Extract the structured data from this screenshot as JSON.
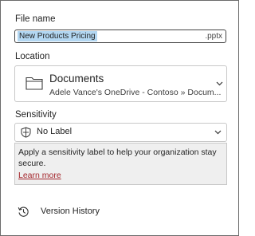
{
  "file_name": {
    "label": "File name",
    "value": "New Products Pricing",
    "extension": ".pptx"
  },
  "location": {
    "label": "Location",
    "folder": "Documents",
    "path": "Adele Vance's OneDrive - Contoso » Docum...",
    "icon": "folder-icon"
  },
  "sensitivity": {
    "label": "Sensitivity",
    "selected": "No Label",
    "icon": "shield-icon",
    "info_text": "Apply a sensitivity label to help your organization stay secure.",
    "learn_more": "Learn more"
  },
  "version_history": {
    "label": "Version History",
    "icon": "history-icon"
  },
  "colors": {
    "selection_highlight": "#b3d7f2",
    "link": "#a4262c",
    "info_background": "#efefef"
  }
}
